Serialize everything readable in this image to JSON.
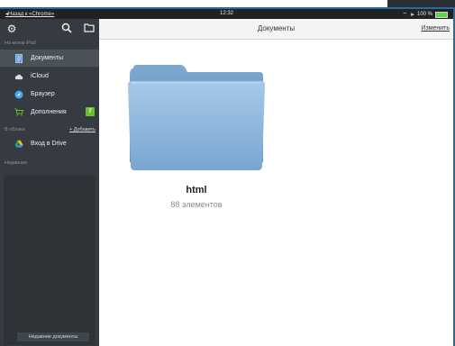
{
  "status_bar": {
    "back_label": "◂Назад к «Chrome»",
    "time": "12:32",
    "right_text": "100 %"
  },
  "sidebar": {
    "top_icons": [
      "gear-icon",
      "search-icon",
      "new-folder-icon"
    ],
    "section_device": "На моем iPad",
    "items": [
      {
        "label": "Документы",
        "icon": "document-icon",
        "active": true
      },
      {
        "label": "iCloud",
        "icon": "cloud-icon"
      },
      {
        "label": "Браузер",
        "icon": "compass-icon"
      },
      {
        "label": "Дополнения",
        "icon": "cart-icon",
        "badge": "7"
      }
    ],
    "section_cloud": "В облаке",
    "add_link": "+ Добавить",
    "drive_item": {
      "label": "Вход в Drive",
      "icon": "drive-icon"
    },
    "section_recent": "Недавние",
    "recent_button": "Недавние документы"
  },
  "main": {
    "title": "Документы",
    "edit_label": "Изменить",
    "folder": {
      "name": "html",
      "count": "88 элементов"
    }
  },
  "colors": {
    "sidebar_bg": "#353b40",
    "accent_blue": "#2e6a94",
    "badge_green": "#6fbf2a",
    "folder_blue": "#89b4d8"
  }
}
